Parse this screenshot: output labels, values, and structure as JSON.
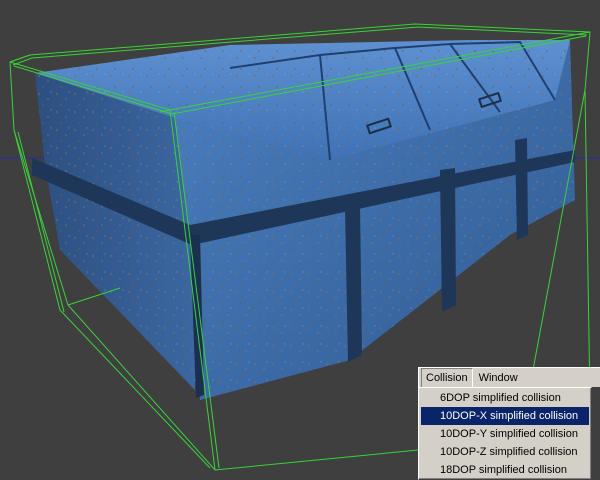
{
  "menubar": {
    "items": [
      {
        "label": "Collision",
        "open": true
      },
      {
        "label": "Window",
        "open": false
      }
    ]
  },
  "dropdown": {
    "items": [
      {
        "label": "6DOP simplified collision",
        "selected": false
      },
      {
        "label": "10DOP-X simplified collision",
        "selected": true
      },
      {
        "label": "10DOP-Y simplified collision",
        "selected": false
      },
      {
        "label": "10DOP-Z simplified collision",
        "selected": false
      },
      {
        "label": "18DOP simplified collision",
        "selected": false
      }
    ]
  },
  "colors": {
    "viewport_bg": "#3f3f3f",
    "collision_wire": "#39d339",
    "dumpster_blue": "#3f6fae",
    "horizon_line": "#2a2ab0",
    "menu_bg": "#d4d0c8",
    "menu_highlight": "#0a246a"
  }
}
